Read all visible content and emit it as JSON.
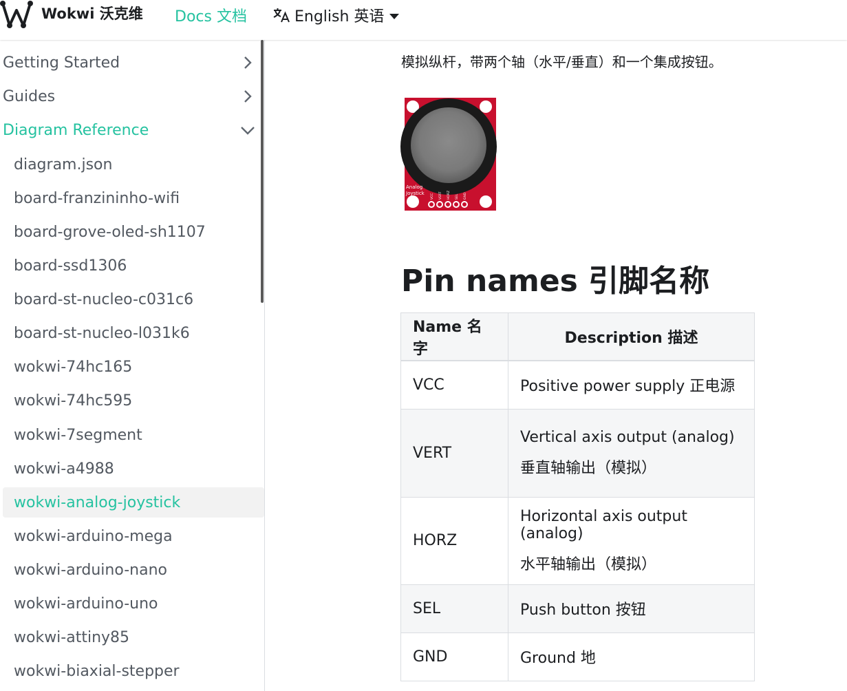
{
  "navbar": {
    "brand_title": "Wokwi 沃克维",
    "docs_label": "Docs 文档",
    "lang_label": "English 英语",
    "logo_icon": "wokwi-logo-icon",
    "lang_icon": "translate-icon",
    "accent_color": "#25c2a0"
  },
  "sidebar": {
    "categories": [
      {
        "label": "Getting Started",
        "icon": "chevron-right-icon"
      },
      {
        "label": "Guides",
        "icon": "chevron-right-icon"
      },
      {
        "label": "Diagram Reference",
        "icon": "chevron-down-icon"
      }
    ],
    "items": [
      {
        "label": "diagram.json"
      },
      {
        "label": "board-franzininho-wifi"
      },
      {
        "label": "board-grove-oled-sh1107"
      },
      {
        "label": "board-ssd1306"
      },
      {
        "label": "board-st-nucleo-c031c6"
      },
      {
        "label": "board-st-nucleo-l031k6"
      },
      {
        "label": "wokwi-74hc165"
      },
      {
        "label": "wokwi-74hc595"
      },
      {
        "label": "wokwi-7segment"
      },
      {
        "label": "wokwi-a4988"
      },
      {
        "label": "wokwi-analog-joystick"
      },
      {
        "label": "wokwi-arduino-mega"
      },
      {
        "label": "wokwi-arduino-nano"
      },
      {
        "label": "wokwi-arduino-uno"
      },
      {
        "label": "wokwi-attiny85"
      },
      {
        "label": "wokwi-biaxial-stepper"
      }
    ],
    "active_item": "wokwi-analog-joystick"
  },
  "main": {
    "intro": "模拟纵杆，带两个轴（水平/垂直）和一个集成按钮。",
    "image": {
      "board_label": [
        "Analog",
        "Joystick"
      ],
      "pin_labels": [
        "VCC",
        "VERT",
        "HORZ",
        "SEL",
        "GND"
      ],
      "board_color": "#c8102e"
    },
    "heading": "Pin names 引脚名称",
    "table": {
      "headers": [
        "Name 名字",
        "Description 描述"
      ],
      "rows": [
        {
          "name": "VCC",
          "desc": [
            "Positive power supply 正电源"
          ]
        },
        {
          "name": "VERT",
          "desc": [
            "Vertical axis output (analog)",
            "垂直轴输出（模拟）"
          ]
        },
        {
          "name": "HORZ",
          "desc": [
            "Horizontal axis output (analog)",
            "水平轴输出（模拟）"
          ]
        },
        {
          "name": "SEL",
          "desc": [
            "Push button 按钮"
          ]
        },
        {
          "name": "GND",
          "desc": [
            "Ground 地"
          ]
        }
      ]
    }
  }
}
